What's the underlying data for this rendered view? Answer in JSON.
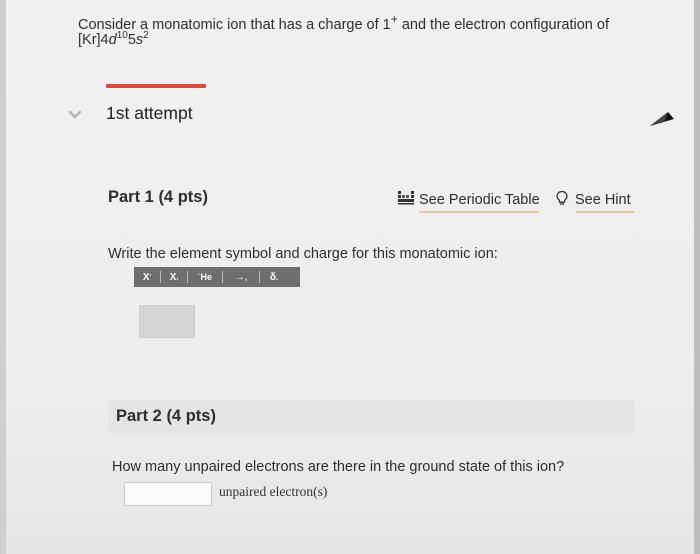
{
  "question": {
    "text_before": "Consider a monatomic ion that has a charge of 1",
    "charge_sup": "+",
    "text_after": " and the electron configuration of",
    "config_base": "[Kr]4",
    "config_d": "d",
    "config_d_sup": "10",
    "config_5": "5",
    "config_s": "s",
    "config_s_sup": "2"
  },
  "attempt": {
    "label": "1st attempt",
    "chevron": "chevron-down-icon"
  },
  "part1": {
    "title": "Part 1 (4 pts)",
    "periodic_label": "See Periodic Table",
    "hint_label": "See Hint",
    "prompt": "Write the element symbol and charge for this monatomic ion:",
    "toolbar": {
      "superscript": "X",
      "superscript_mark": "'",
      "subscript": "X",
      "subscript_mark": ",",
      "isotope": "He",
      "arrow": "→",
      "arrow_mark": ",",
      "delta": "δ",
      "delta_mark": "."
    }
  },
  "part2": {
    "title": "Part 2 (4 pts)",
    "prompt": "How many unpaired electrons are there in the ground state of this ion?",
    "unit": "unpaired electron(s)"
  },
  "colors": {
    "accent_red": "#d54a3c",
    "underline": "#e2c9a1",
    "toolbar": "#6e6e6e"
  }
}
